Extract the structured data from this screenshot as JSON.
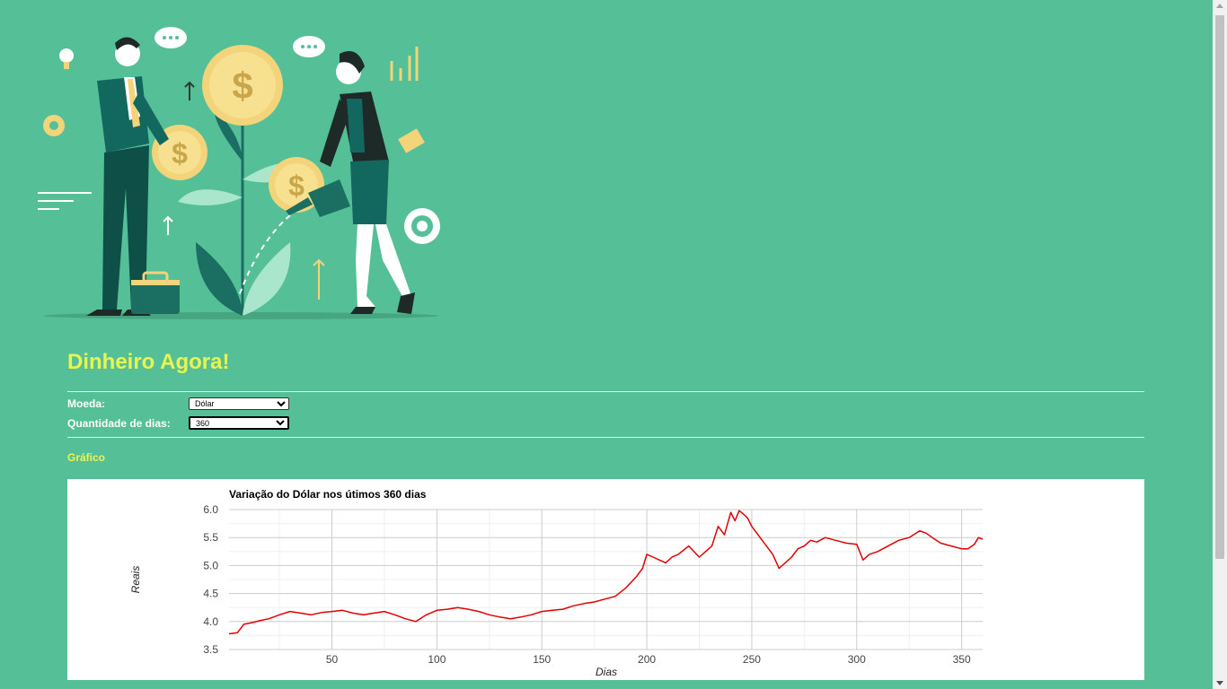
{
  "page": {
    "title": "Dinheiro Agora!"
  },
  "form": {
    "moeda": {
      "label": "Moeda:",
      "value": "Dólar"
    },
    "dias": {
      "label": "Quantidade de dias:",
      "value": "360"
    }
  },
  "section": {
    "title": "Gráfico"
  },
  "colors": {
    "background": "#55bf97",
    "title": "#e8f550",
    "series": "#e00000"
  },
  "chart_data": {
    "type": "line",
    "title": "Variação do Dólar nos útimos 360 dias",
    "xlabel": "Dias",
    "ylabel": "Reais",
    "xlim": [
      1,
      360
    ],
    "ylim": [
      3.5,
      6.0
    ],
    "x_ticks": [
      50,
      100,
      150,
      200,
      250,
      300,
      350
    ],
    "y_ticks": [
      3.5,
      4.0,
      4.5,
      5.0,
      5.5,
      6.0
    ],
    "grid": true,
    "legend": "none",
    "series": [
      {
        "x": [
          1,
          5,
          8,
          12,
          16,
          20,
          25,
          30,
          35,
          40,
          45,
          50,
          55,
          60,
          65,
          70,
          75,
          80,
          85,
          90,
          95,
          100,
          105,
          110,
          115,
          120,
          125,
          130,
          135,
          140,
          145,
          150,
          155,
          160,
          165,
          170,
          175,
          180,
          185,
          190,
          195,
          198,
          200,
          203,
          206,
          209,
          212,
          215,
          220,
          225,
          228,
          231,
          234,
          237,
          240,
          242,
          244,
          246,
          248,
          250,
          253,
          256,
          260,
          263,
          266,
          269,
          272,
          275,
          278,
          281,
          285,
          290,
          295,
          300,
          303,
          306,
          310,
          315,
          320,
          325,
          330,
          333,
          336,
          340,
          345,
          350,
          353,
          356,
          358,
          360
        ],
        "y": [
          3.78,
          3.8,
          3.95,
          3.98,
          4.02,
          4.05,
          4.12,
          4.18,
          4.15,
          4.12,
          4.16,
          4.18,
          4.2,
          4.15,
          4.12,
          4.15,
          4.18,
          4.12,
          4.05,
          4.0,
          4.12,
          4.2,
          4.22,
          4.25,
          4.22,
          4.18,
          4.12,
          4.08,
          4.05,
          4.08,
          4.12,
          4.18,
          4.2,
          4.22,
          4.28,
          4.32,
          4.35,
          4.4,
          4.45,
          4.6,
          4.8,
          4.95,
          5.2,
          5.15,
          5.1,
          5.05,
          5.15,
          5.2,
          5.35,
          5.15,
          5.25,
          5.35,
          5.7,
          5.55,
          5.95,
          5.8,
          5.98,
          5.92,
          5.85,
          5.7,
          5.55,
          5.4,
          5.2,
          4.95,
          5.05,
          5.15,
          5.3,
          5.35,
          5.45,
          5.42,
          5.5,
          5.45,
          5.4,
          5.38,
          5.1,
          5.2,
          5.25,
          5.35,
          5.45,
          5.5,
          5.62,
          5.58,
          5.5,
          5.4,
          5.35,
          5.3,
          5.3,
          5.38,
          5.5,
          5.47
        ]
      }
    ]
  }
}
